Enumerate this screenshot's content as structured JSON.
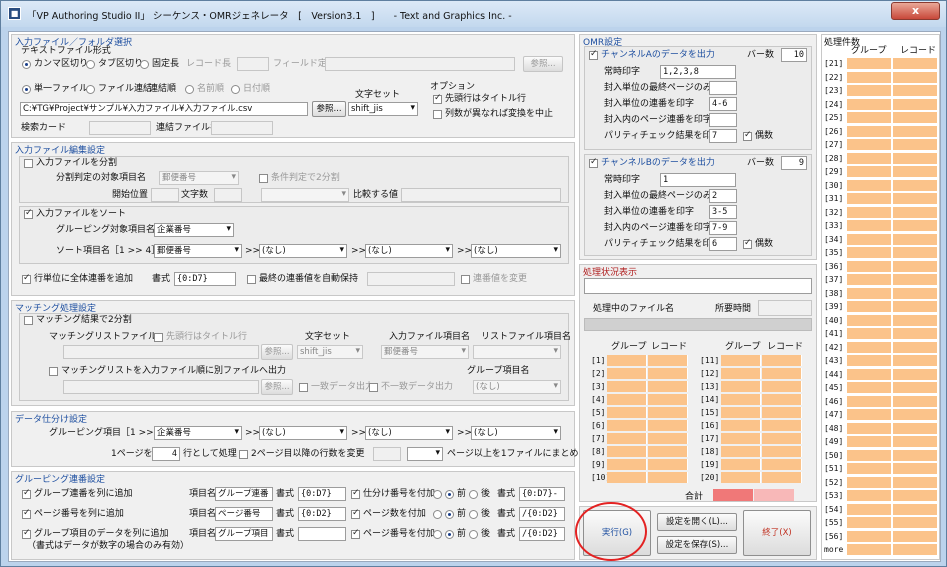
{
  "title": "「VP Authoring Studio II」 シーケンス・OMRジェネレータ　[　Version3.1　]　　- Text and Graphics Inc. -",
  "close_label": "x",
  "input": {
    "section": "入力ファイル／フォルダ選択",
    "textformat": "テキストファイル形式",
    "r_comma": "カンマ区切り",
    "r_tab": "タブ区切り",
    "r_fixed": "固定長",
    "reclen": "レコード長",
    "fielddef": "フィールド定義",
    "browse": "参照...",
    "r_single": "単一ファイル",
    "r_concat": "ファイル連結",
    "concat_order": "連結順",
    "r_name": "名前順",
    "r_date": "日付順",
    "charset_label": "文字セット",
    "filepath": "C:¥TG¥Project¥サンプル¥入力ファイル¥入力ファイル.csv",
    "browse2": "参照...",
    "charset": "shift_jis",
    "option_label": "オプション",
    "opt1": "先頭行はタイトル行",
    "opt2": "列数が異なれば変換を中止",
    "search_card": "検索カード",
    "concat_filename": "連結ファイル名"
  },
  "edit": {
    "section": "入力ファイル編集設定",
    "split": "入力ファイルを分割",
    "split_item": "分割判定の対象項目名",
    "split_item_val": "郵便番号",
    "cond_split": "条件判定で2分割",
    "start_pos": "開始位置",
    "char_count": "文字数",
    "compare_val": "比較する値",
    "sort": "入力ファイルをソート",
    "group_item": "グルーピング対象項目名",
    "group_item_val": "企業番号",
    "sort_items": "ソート項目名［1 >> 4］",
    "sort1": "郵便番号",
    "sort2": "(なし)",
    "sort3": "(なし)",
    "sort4": "(なし)",
    "arrow": ">>",
    "serial_add": "行単位に全体連番を追加",
    "format_label": "書式",
    "serial_format": "{0:D7}",
    "auto_keep": "最終の連番値を自動保持",
    "serial_change": "連番値を変更"
  },
  "match": {
    "section": "マッチング処理設定",
    "split2": "マッチング結果で2分割",
    "list_file": "マッチングリストファイル",
    "title_row": "先頭行はタイトル行",
    "charset_label": "文字セット",
    "input_item": "入力ファイル項目名",
    "list_item": "リストファイル項目名",
    "browse": "参照...",
    "charset": "shift_jis",
    "input_item_val": "郵便番号",
    "list_item_val": "",
    "per_file": "マッチングリストを入力ファイル順に別ファイルへ出力",
    "group_item": "グループ項目名",
    "browse2": "参照...",
    "match_out": "一致データ出力",
    "nomatch_out": "不一致データ出力",
    "group_val": "(なし)"
  },
  "dist": {
    "section": "データ仕分け設定",
    "group_items": "グルーピング項目［1 >> 4］",
    "g1": "企業番号",
    "g2": "(なし)",
    "g3": "(なし)",
    "g4": "(なし)",
    "page_label": "1ページを",
    "lines": "4",
    "lines_label": "行として処理",
    "change_lines": "2ページ目以降の行数を変更",
    "page_over": "ページ以上を1ファイルにまとめる"
  },
  "gserial": {
    "section": "グルーピング連番設定",
    "row1": "グループ連番を列に追加",
    "row2": "ページ番号を列に追加",
    "row3": "グループ項目のデータを列に追加",
    "note": "（書式はデータが数字の場合のみ有効）",
    "item_label": "項目名",
    "format_label": "書式",
    "item1": "グループ連番",
    "fmt1": "{0:D7}",
    "item2": "ページ番号",
    "fmt2": "{0:D2}",
    "item3": "グループ項目",
    "fmt3": "",
    "opt1": "仕分け番号を付加",
    "opt2": "ページ数を付加",
    "opt3": "ページ番号を付加",
    "before": "前",
    "after": "後",
    "ofmt1": "{0:D7}-",
    "ofmt2": "/{0:D2}",
    "ofmt3": "/{0:D2}"
  },
  "omr": {
    "section": "OMR設定",
    "cha": "チャンネルAのデータを出力",
    "bar_label": "バー数",
    "bars_a": "10",
    "always": "常時印字",
    "always_a": "1,2,3,8",
    "last_only": "封入単位の最終ページのみ印字",
    "last_a": "",
    "seq_print": "封入単位の連番を印字",
    "seq_a": "4-6",
    "page_seq": "封入内のページ連番を印字",
    "page_a": "",
    "parity": "パリティチェック結果を印字",
    "parity_a": "7",
    "even": "偶数",
    "chb": "チャンネルBのデータを出力",
    "bars_b": "9",
    "always_b": "1",
    "last_b": "2",
    "seq_b": "3-5",
    "page_b": "7-9",
    "parity_b": "6"
  },
  "status": {
    "section": "処理状況表示",
    "file_label": "処理中のファイル名",
    "time_label": "所要時間",
    "group": "グループ",
    "record": "レコード",
    "rows_left": [
      "[1]",
      "[2]",
      "[3]",
      "[4]",
      "[5]",
      "[6]",
      "[7]",
      "[8]",
      "[9]",
      "[10]"
    ],
    "rows_right": [
      "[11]",
      "[12]",
      "[13]",
      "[14]",
      "[15]",
      "[16]",
      "[17]",
      "[18]",
      "[19]",
      "[20]"
    ],
    "total": "合計"
  },
  "actions": {
    "run": "実行(G)",
    "open": "設定を開く(L)...",
    "save": "設定を保存(S)...",
    "exit": "終了(X)"
  },
  "count": {
    "section": "処理件数",
    "group": "グループ",
    "record": "レコード",
    "rows": [
      "[21]",
      "[22]",
      "[23]",
      "[24]",
      "[25]",
      "[26]",
      "[27]",
      "[28]",
      "[29]",
      "[30]",
      "[31]",
      "[32]",
      "[33]",
      "[34]",
      "[35]",
      "[36]",
      "[37]",
      "[38]",
      "[39]",
      "[40]",
      "[41]",
      "[42]",
      "[43]",
      "[44]",
      "[45]",
      "[46]",
      "[47]",
      "[48]",
      "[49]",
      "[50]",
      "[51]",
      "[52]",
      "[53]",
      "[54]",
      "[55]",
      "[56]",
      "more"
    ]
  }
}
